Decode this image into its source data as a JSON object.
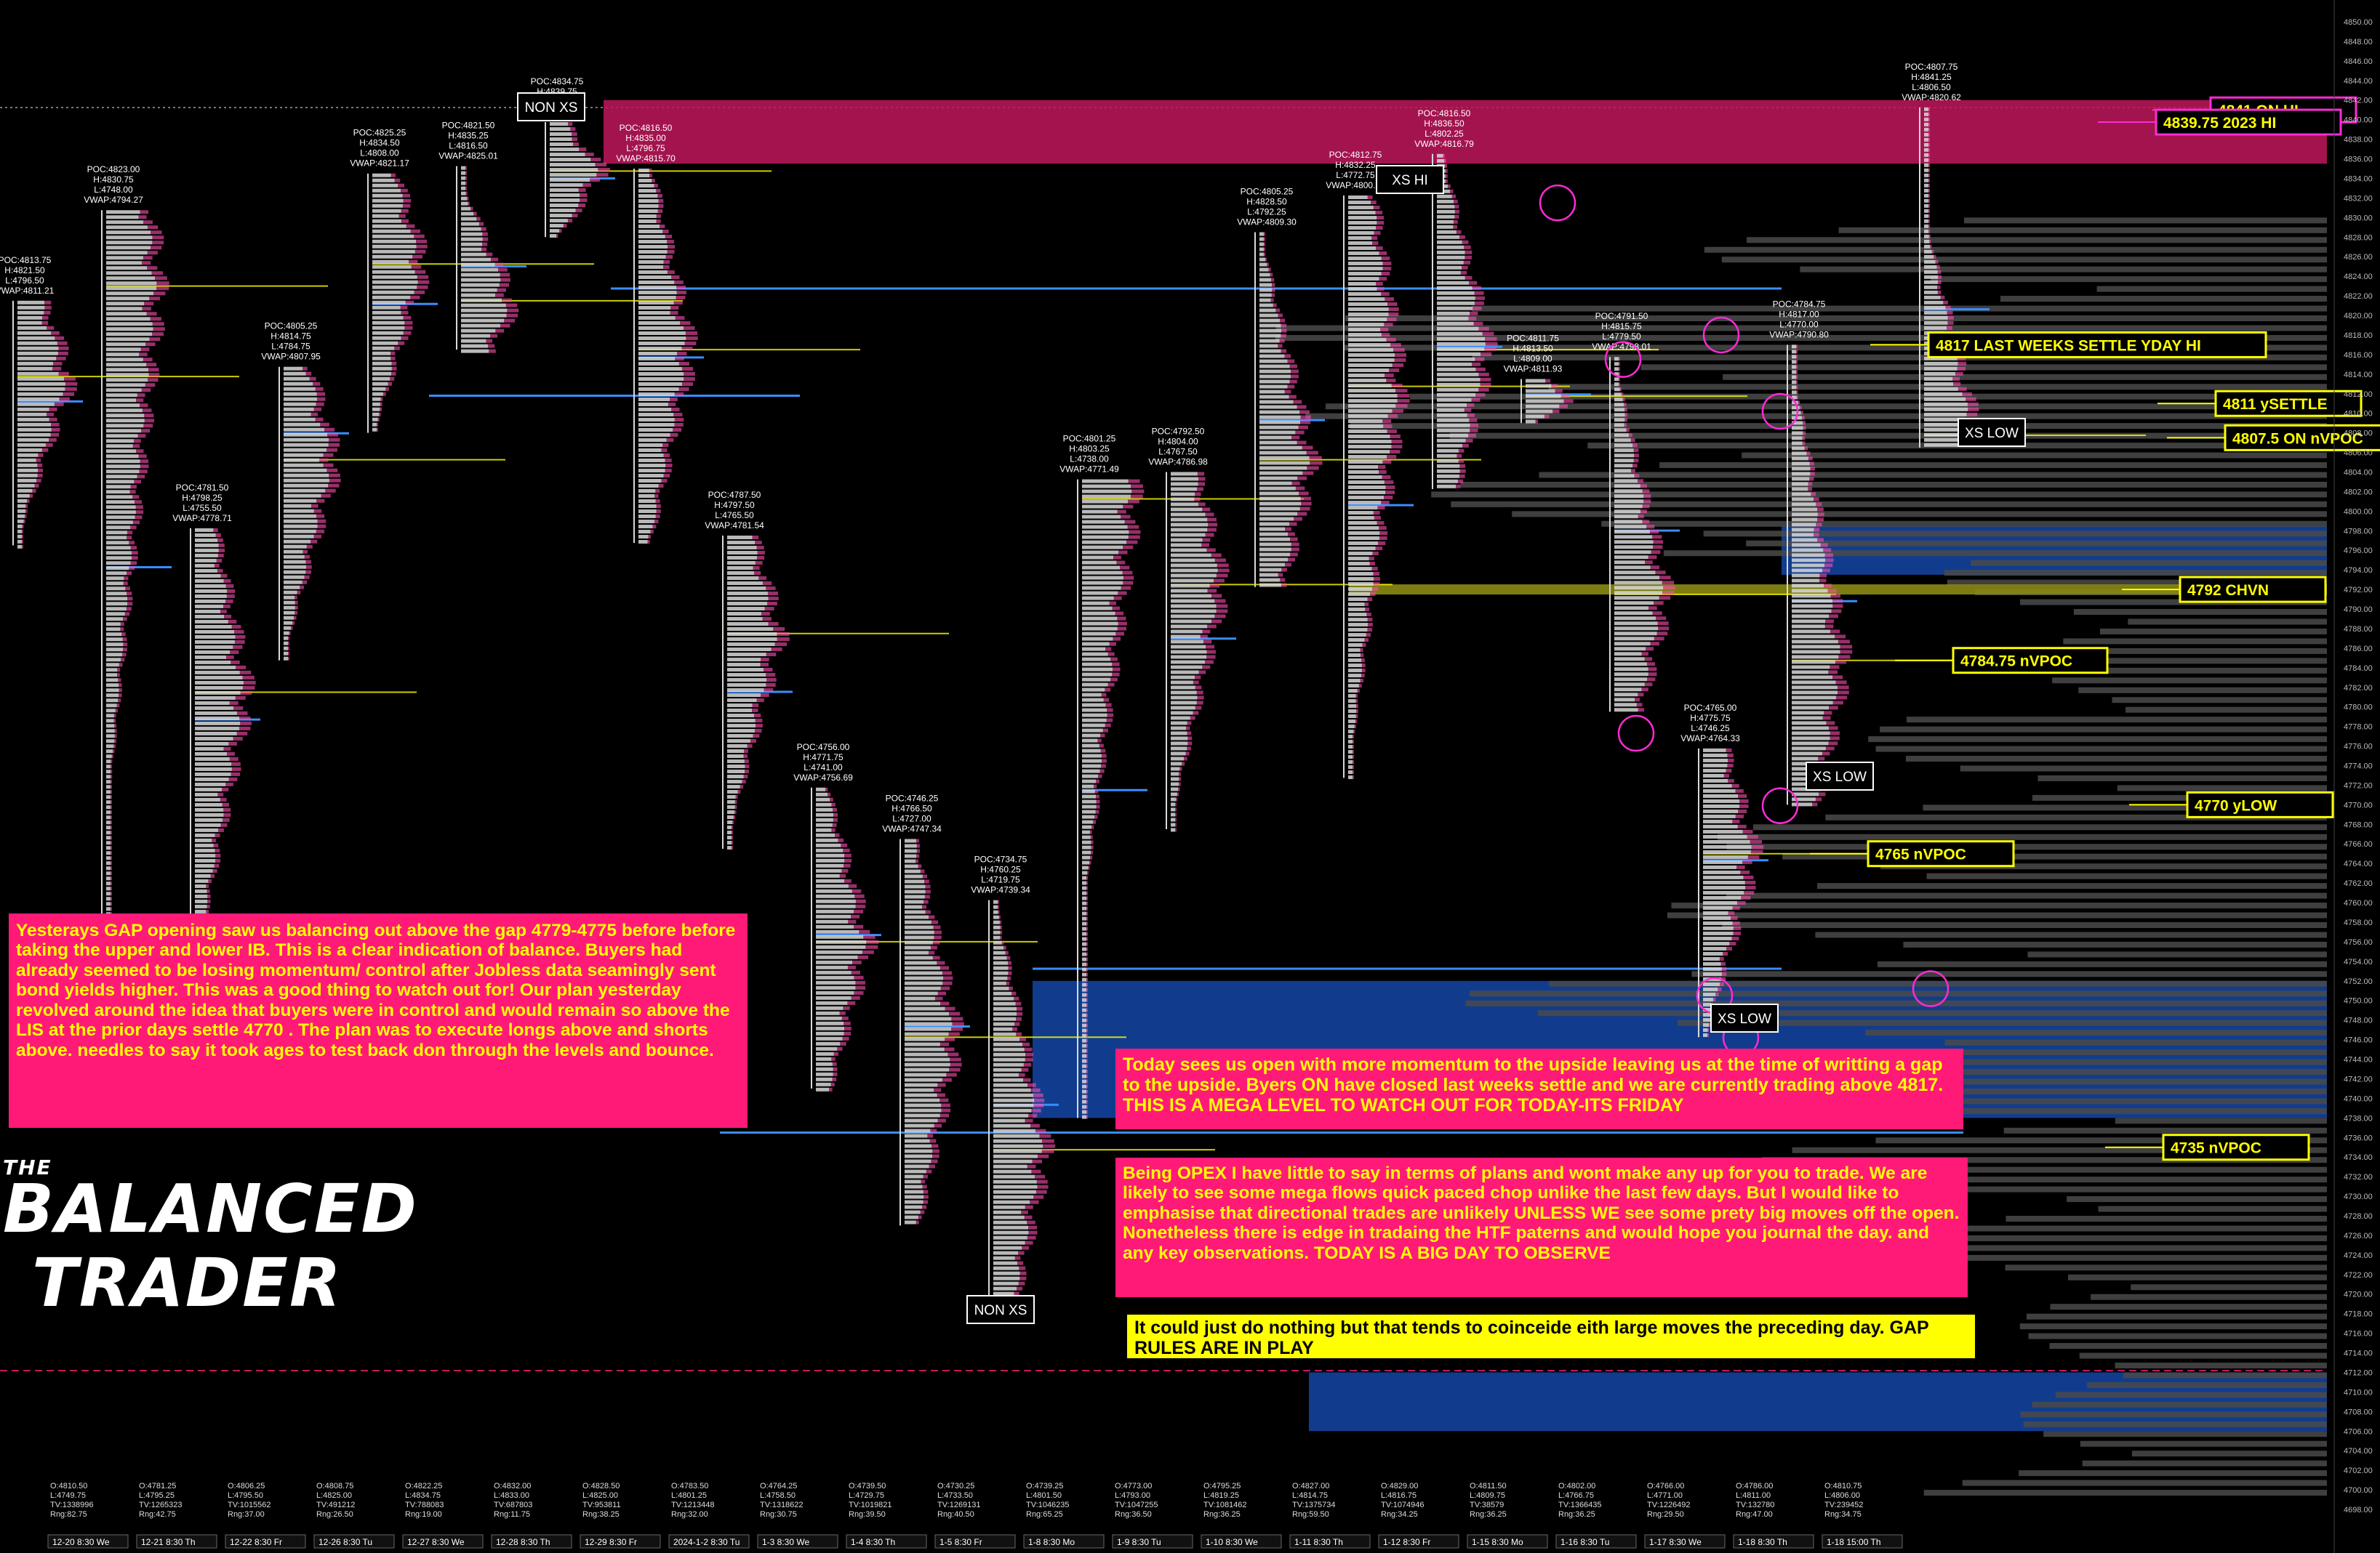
{
  "chart_data": {
    "type": "market-profile",
    "instrument_price_axis": {
      "min": 4698,
      "max": 4850,
      "tick_step": 2
    },
    "colors": {
      "background": "#000000",
      "profile_tpo": "#d9d9d9",
      "profile_volume": "#c0c0c0",
      "poc_line": "#ffff00",
      "value_edge": "#ff2bd6",
      "blue_level": "#3a8dff",
      "composite_volume": "#4a4a4a",
      "zone_red": "#c0185c",
      "zone_blue": "#1446a6",
      "label_border": "#ffff00",
      "note_pink": "#ff1a78",
      "note_yellow": "#ffff00"
    },
    "sessions": [
      {
        "date_label": "12-20  8:30  We",
        "poc": 4813.75,
        "high": 4821.5,
        "low": 4796.5,
        "vwap": 4811.21,
        "stats": [
          "O:4810.50",
          "L:4749.75",
          "TV:1338996",
          "Rng:82.75"
        ],
        "poc_label": "POC:4813.75",
        "h_label": "H:4821.50",
        "l_label": "L:4796.50",
        "vwap_label": "VWAP:4811.21"
      },
      {
        "date_label": "12-21  8:30  Th",
        "poc": 4823.0,
        "high": 4830.75,
        "low": 4748.0,
        "vwap": 4794.27,
        "stats": [
          "O:4781.25",
          "L:4795.25",
          "TV:1265323",
          "Rng:42.75"
        ],
        "poc_label": "POC:4823.00",
        "h_label": "H:4830.75",
        "l_label": "L:4748.00",
        "vwap_label": "VWAP:4794.27"
      },
      {
        "date_label": "12-22  8:30  Fr",
        "poc": 4781.5,
        "high": 4798.25,
        "low": 4755.5,
        "vwap": 4778.71,
        "stats": [
          "O:4806.25",
          "L:4795.50",
          "TV:1015562",
          "Rng:37.00"
        ],
        "poc_label": "POC:4781.50",
        "h_label": "H:4798.25",
        "l_label": "L:4755.50",
        "vwap_label": "VWAP:4778.71"
      },
      {
        "date_label": "12-26  8:30  Tu",
        "poc": 4805.25,
        "high": 4814.75,
        "low": 4784.75,
        "vwap": 4807.95,
        "stats": [
          "O:4808.75",
          "L:4825.00",
          "TV:491212",
          "Rng:26.50"
        ],
        "poc_label": "POC:4805.25",
        "h_label": "H:4814.75",
        "l_label": "L:4784.75",
        "vwap_label": "VWAP:4807.95"
      },
      {
        "date_label": "12-27  8:30  We",
        "poc": 4825.25,
        "high": 4834.5,
        "low": 4808.0,
        "vwap": 4821.17,
        "stats": [
          "O:4822.25",
          "L:4834.75",
          "TV:788083",
          "Rng:19.00"
        ],
        "poc_label": "POC:4825.25",
        "h_label": "H:4834.50",
        "l_label": "L:4808.00",
        "vwap_label": "VWAP:4821.17"
      },
      {
        "date_label": "12-28  8:30  Th",
        "poc": 4821.5,
        "high": 4835.25,
        "low": 4816.5,
        "vwap": 4825.01,
        "stats": [
          "O:4832.00",
          "L:4833.00",
          "TV:687803",
          "Rng:11.75"
        ],
        "poc_label": "POC:4821.50",
        "h_label": "H:4835.25",
        "l_label": "L:4816.50",
        "vwap_label": "VWAP:4825.01"
      },
      {
        "date_label": "12-29  8:30  Fr",
        "poc": 4834.75,
        "high": 4839.75,
        "low": 4828.0,
        "vwap": 4834.0,
        "stats": [
          "O:4828.50",
          "L:4825.00",
          "TV:953811",
          "Rng:38.25"
        ],
        "poc_label": "POC:4834.75",
        "h_label": "H:4839.75",
        "l_label": "L:4828.00",
        "vwap_label": ""
      },
      {
        "date_label": "2024-1-2  8:30  Tu",
        "poc": 4816.5,
        "high": 4835.0,
        "low": 4796.75,
        "vwap": 4815.7,
        "stats": [
          "O:4783.50",
          "L:4801.25",
          "TV:1213448",
          "Rng:32.00"
        ],
        "poc_label": "POC:4816.50",
        "h_label": "H:4835.00",
        "l_label": "L:4796.75",
        "vwap_label": "VWAP:4815.70"
      },
      {
        "date_label": "1-3  8:30  We",
        "poc": 4787.5,
        "high": 4797.5,
        "low": 4765.5,
        "vwap": 4781.54,
        "stats": [
          "O:4764.25",
          "L:4758.50",
          "TV:1318622",
          "Rng:30.75"
        ],
        "poc_label": "POC:4787.50",
        "h_label": "H:4797.50",
        "l_label": "L:4765.50",
        "vwap_label": "VWAP:4781.54"
      },
      {
        "date_label": "1-4  8:30  Th",
        "poc": 4756.0,
        "high": 4771.75,
        "low": 4741.0,
        "vwap": 4756.69,
        "stats": [
          "O:4739.50",
          "L:4729.75",
          "TV:1019821",
          "Rng:39.50"
        ],
        "poc_label": "POC:4756.00",
        "h_label": "H:4771.75",
        "l_label": "L:4741.00",
        "vwap_label": "VWAP:4756.69"
      },
      {
        "date_label": "1-5  8:30  Fr",
        "poc": 4746.25,
        "high": 4766.5,
        "low": 4727.0,
        "vwap": 4747.34,
        "stats": [
          "O:4730.25",
          "L:4733.50",
          "TV:1269131",
          "Rng:40.50"
        ],
        "poc_label": "POC:4746.25",
        "h_label": "H:4766.50",
        "l_label": "L:4727.00",
        "vwap_label": "VWAP:4747.34"
      },
      {
        "date_label": "1-8  8:30  Mo",
        "poc": 4734.75,
        "high": 4760.25,
        "low": 4719.75,
        "vwap": 4739.34,
        "stats": [
          "O:4739.25",
          "L:4801.50",
          "TV:1046235",
          "Rng:65.25"
        ],
        "poc_label": "POC:4734.75",
        "h_label": "H:4760.25",
        "l_label": "L:4719.75",
        "vwap_label": "VWAP:4739.34"
      },
      {
        "date_label": "1-9  8:30  Tu",
        "poc": 4801.25,
        "high": 4803.25,
        "low": 4738.0,
        "vwap": 4771.49,
        "stats": [
          "O:4773.00",
          "L:4793.00",
          "TV:1047255",
          "Rng:36.50"
        ],
        "poc_label": "POC:4801.25",
        "h_label": "H:4803.25",
        "l_label": "L:4738.00",
        "vwap_label": "VWAP:4771.49"
      },
      {
        "date_label": "1-10  8:30  We",
        "poc": 4792.5,
        "high": 4804.0,
        "low": 4767.5,
        "vwap": 4786.98,
        "stats": [
          "O:4795.25",
          "L:4819.25",
          "TV:1081462",
          "Rng:36.25"
        ],
        "poc_label": "POC:4792.50",
        "h_label": "H:4804.00",
        "l_label": "L:4767.50",
        "vwap_label": "VWAP:4786.98"
      },
      {
        "date_label": "1-11  8:30  Th",
        "poc": 4805.25,
        "high": 4828.5,
        "low": 4792.25,
        "vwap": 4809.3,
        "stats": [
          "O:4827.00",
          "L:4814.75",
          "TV:1375734",
          "Rng:59.50"
        ],
        "poc_label": "POC:4805.25",
        "h_label": "H:4828.50",
        "l_label": "L:4792.25",
        "vwap_label": "VWAP:4809.30"
      },
      {
        "date_label": "1-12  8:30  Fr",
        "poc": 4812.75,
        "high": 4832.25,
        "low": 4772.75,
        "vwap": 4800.61,
        "stats": [
          "O:4829.00",
          "L:4816.75",
          "TV:1074946",
          "Rng:34.25"
        ],
        "poc_label": "POC:4812.75",
        "h_label": "H:4832.25",
        "l_label": "L:4772.75",
        "vwap_label": "VWAP:4800.61"
      },
      {
        "date_label": "1-15  8:30  Mo",
        "poc": 4816.5,
        "high": 4836.5,
        "low": 4802.25,
        "vwap": 4816.79,
        "stats": [
          "O:4811.50",
          "L:4809.75",
          "TV:38579",
          "Rng:36.25"
        ],
        "poc_label": "POC:4816.50",
        "h_label": "H:4836.50",
        "l_label": "L:4802.25",
        "vwap_label": "VWAP:4816.79"
      },
      {
        "date_label": "1-16  8:30  Tu",
        "poc": 4811.75,
        "high": 4813.5,
        "low": 4809.0,
        "vwap": 4811.93,
        "stats": [
          "O:4802.00",
          "L:4766.75",
          "TV:1366435",
          "Rng:36.25"
        ],
        "poc_label": "POC:4811.75",
        "h_label": "H:4813.50",
        "l_label": "L:4809.00",
        "vwap_label": "VWAP:4811.93"
      },
      {
        "date_label": "1-17  8:30  We",
        "poc": 4791.5,
        "high": 4815.75,
        "low": 4779.5,
        "vwap": 4798.01,
        "stats": [
          "O:4766.00",
          "L:4771.00",
          "TV:1226492",
          "Rng:29.50"
        ],
        "poc_label": "POC:4791.50",
        "h_label": "H:4815.75",
        "l_label": "L:4779.50",
        "vwap_label": "VWAP:4798.01"
      },
      {
        "date_label": "1-18  8:30  Th",
        "poc": 4765.0,
        "high": 4775.75,
        "low": 4746.25,
        "vwap": 4764.33,
        "stats": [
          "O:4786.00",
          "L:4811.00",
          "TV:132780",
          "Rng:47.00"
        ],
        "poc_label": "POC:4765.00",
        "h_label": "H:4775.75",
        "l_label": "L:4746.25",
        "vwap_label": "VWAP:4764.33"
      },
      {
        "date_label": "1-18  15:00  Th",
        "poc": 4784.75,
        "high": 4817.0,
        "low": 4770.0,
        "vwap": 4790.8,
        "stats": [
          "O:4810.75",
          "L:4806.00",
          "TV:239452",
          "Rng:34.75"
        ],
        "poc_label": "POC:4784.75",
        "h_label": "H:4817.00",
        "l_label": "L:4770.00",
        "vwap_label": "VWAP:4790.80"
      },
      {
        "date_label": "",
        "poc": 4807.75,
        "high": 4841.25,
        "low": 4806.5,
        "vwap": 4820.62,
        "stats": [],
        "poc_label": "POC:4807.75",
        "h_label": "H:4841.25",
        "l_label": "L:4806.50",
        "vwap_label": "VWAP:4820.62"
      }
    ],
    "levels": [
      {
        "price": 4841.0,
        "label": "4841 ON HI",
        "color": "#ff2bd6"
      },
      {
        "price": 4839.75,
        "label": "4839.75  2023 HI",
        "color": "#ff2bd6"
      },
      {
        "price": 4817.0,
        "label": "4817  LAST WEEKS SETTLE YDAY HI",
        "color": "#ffff00"
      },
      {
        "price": 4807.5,
        "label": "4807.5 ON nVPOC",
        "color": "#ffff00"
      },
      {
        "price": 4811.0,
        "label": "4811 ySETTLE",
        "color": "#ffff00"
      },
      {
        "price": 4792.0,
        "label": "4792   CHVN",
        "color": "#ffff00"
      },
      {
        "price": 4784.75,
        "label": "4784.75 nVPOC",
        "color": "#ffff00"
      },
      {
        "price": 4770.0,
        "label": "4770 yLOW",
        "color": "#ffff00"
      },
      {
        "price": 4765.0,
        "label": "4765  nVPOC",
        "color": "#ffff00"
      },
      {
        "price": 4735.0,
        "label": "4735  nVPOC",
        "color": "#ffff00"
      }
    ],
    "boxes": [
      {
        "label": "NON XS"
      },
      {
        "label": "XS HI"
      },
      {
        "label": "XS LOW"
      },
      {
        "label": "XS LOW"
      },
      {
        "label": "XS LOW"
      },
      {
        "label": "NON XS"
      }
    ],
    "zones": [
      {
        "from": 4835.5,
        "to": 4842.0,
        "color": "#c0185c"
      },
      {
        "from": 4793.5,
        "to": 4798.5,
        "color": "#1446a6"
      },
      {
        "from": 4738.0,
        "to": 4752.0,
        "color": "#1446a6"
      },
      {
        "from": 4706.0,
        "to": 4712.0,
        "color": "#1446a6"
      }
    ]
  },
  "notes": {
    "note1": "Yesterays GAP opening saw us balancing out  above the gap 4779-4775 before   before taking the upper and lower IB. This is a clear indication of balance. Buyers   had already seemed  to be losing momentum/ control after Jobless data   seamingly sent bond yields higher. This  was a  good  thing to watch out for! Our plan yesterday revolved around the idea that buyers were in control and  would remain so above the LIS at the prior days settle 4770 .  The plan was to execute  longs above and shorts above. needles to say it took ages to test back don through the levels and bounce.",
    "note2": "Today sees us open with more momentum  to the upside leaving us at the time of writting a gap to the upside.  Byers ON  have closed  last weeks settle and we are currently trading above 4817. THIS IS A MEGA LEVEL TO WATCH OUT FOR TODAY-ITS FRIDAY",
    "note3": "Being OPEX  I have little to say in terms of plans and wont make any up for you  to trade. We are likely to see some mega flows  quick paced chop unlike the last few days.  But I would  like  to emphasise      that directional trades are unlikely  UNLESS WE see some prety big moves off the open. Nonetheless  there is edge in tradaing the HTF paterns  and would  hope you journal  the day.  and any key observations.  TODAY IS A BIG  DAY TO OBSERVE",
    "note4": "It could just do nothing   but  that tends to coinceide eith large moves the preceding day. GAP RULES ARE IN PLAY"
  },
  "logo": {
    "line1": "THE",
    "line2": "BALANCED",
    "line3": "TRADER"
  }
}
